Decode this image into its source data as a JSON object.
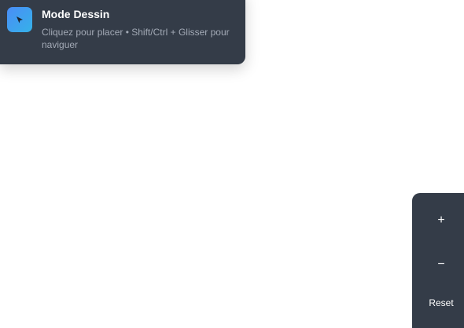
{
  "banner": {
    "icon": "cursor-arrow-icon",
    "title": "Mode Dessin",
    "hint": "Cliquez pour placer • Shift/Ctrl + Glisser pour naviguer"
  },
  "zoom_controls": {
    "zoom_in_label": "+",
    "zoom_out_label": "−",
    "reset_label": "Reset"
  },
  "colors": {
    "panel_bg": "#343c48",
    "icon_gradient_start": "#4a8df7",
    "icon_gradient_end": "#35b2e8",
    "hint_text": "#a3aab6",
    "canvas_bg": "#ffffff"
  }
}
